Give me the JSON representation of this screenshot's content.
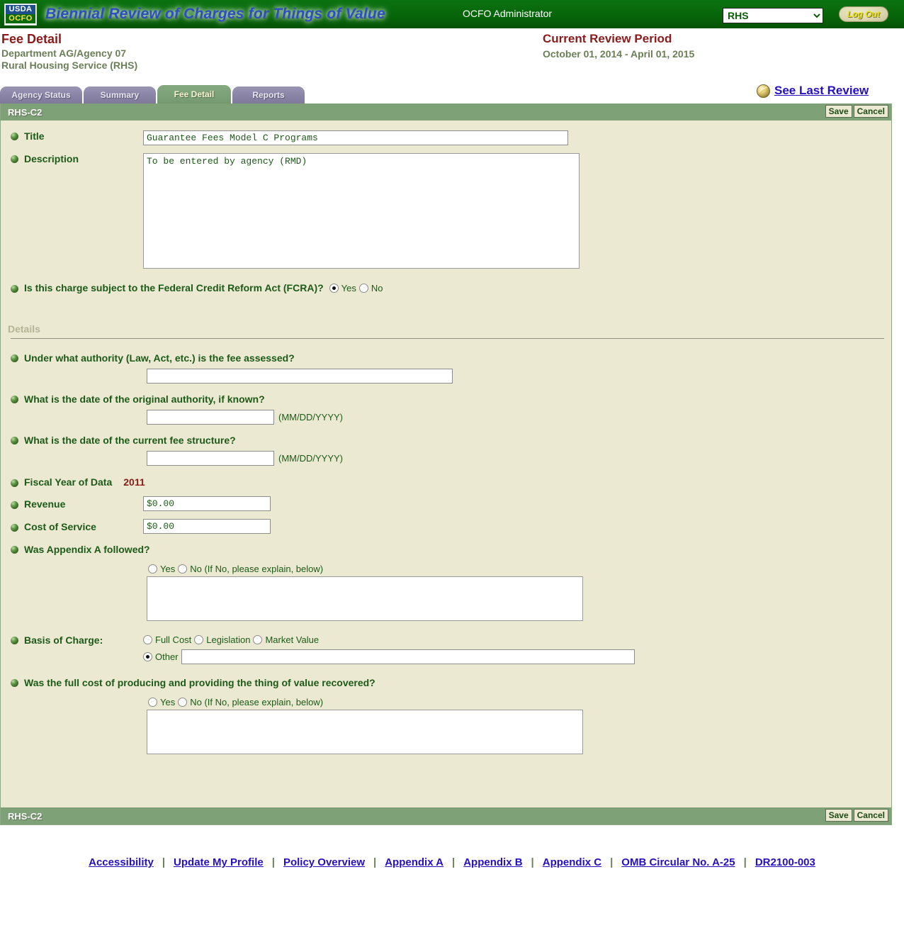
{
  "header": {
    "logo_top": "USDA",
    "logo_bottom": "OCFO",
    "banner_title": "Biennial Review of Charges for Things of Value",
    "user_role": "OCFO Administrator",
    "agency_selected": "RHS",
    "agency_options": [
      "RHS"
    ],
    "logout_label": "Log Out",
    "colors": {
      "bar_green": "#0a6b0a",
      "banner_blue": "#2a4fbe",
      "logout_bg": "#ddd8b0"
    }
  },
  "title_block": {
    "page_title": "Fee Detail",
    "department_line": "Department AG/Agency 07",
    "agency_line": "Rural Housing Service (RHS)",
    "review_period_title": "Current Review Period",
    "review_period_dates": "October 01, 2014 - April 01, 2015",
    "colors": {
      "maroon": "#8b1a1a",
      "sage": "#6b7f57"
    }
  },
  "see_last_review": {
    "icon": "globe-icon",
    "label": "See Last Review"
  },
  "tabs": [
    {
      "label": "Agency Status",
      "active": false
    },
    {
      "label": "Summary",
      "active": false
    },
    {
      "label": "Fee Detail",
      "active": true
    },
    {
      "label": "Reports",
      "active": false
    }
  ],
  "panel": {
    "header_title": "RHS-C2",
    "footer_title": "RHS-C2",
    "save_label": "Save",
    "cancel_label": "Cancel"
  },
  "form": {
    "title": {
      "label": "Title",
      "value": "Guarantee Fees Model C Programs",
      "placeholder": ""
    },
    "description": {
      "label": "Description",
      "value": "To be entered by agency (RMD)",
      "placeholder": ""
    },
    "fcra": {
      "label": "Is this charge subject to the Federal Credit Reform Act (FCRA)?",
      "options": [
        {
          "label": "Yes",
          "checked": true
        },
        {
          "label": "No",
          "checked": false
        }
      ]
    },
    "details_section_label": "Details",
    "authority": {
      "label": "Under what authority (Law, Act, etc.) is the fee assessed?",
      "value": "",
      "placeholder": ""
    },
    "original_authority_date": {
      "label": "What is the date of the original authority, if known?",
      "value": "",
      "placeholder": "",
      "hint": "(MM/DD/YYYY)"
    },
    "current_fee_structure_date": {
      "label": "What is the date of the current fee structure?",
      "value": "",
      "placeholder": "",
      "hint": "(MM/DD/YYYY)"
    },
    "fiscal_year": {
      "label": "Fiscal Year of Data",
      "value": "2011"
    },
    "revenue": {
      "label": "Revenue",
      "value": "$0.00"
    },
    "cost_of_service": {
      "label": "Cost of Service",
      "value": "$0.00"
    },
    "appendix_a": {
      "label": "Was Appendix A followed?",
      "options": [
        {
          "label": "Yes",
          "checked": false
        },
        {
          "label": "No (If No, please explain, below)",
          "checked": false
        }
      ],
      "explain_value": "",
      "explain_placeholder": ""
    },
    "basis_of_charge": {
      "label": "Basis of Charge:",
      "options": [
        {
          "label": "Full Cost",
          "checked": false
        },
        {
          "label": "Legislation",
          "checked": false
        },
        {
          "label": "Market Value",
          "checked": false
        },
        {
          "label": "Other",
          "checked": true
        }
      ],
      "other_value": "",
      "other_placeholder": ""
    },
    "full_cost_recovered": {
      "label": "Was the full cost of producing and providing the thing of value recovered?",
      "options": [
        {
          "label": "Yes",
          "checked": false
        },
        {
          "label": "No (If No, please explain, below)",
          "checked": false
        }
      ],
      "explain_value": "",
      "explain_placeholder": ""
    }
  },
  "footer": {
    "links": [
      "Accessibility",
      "Update My Profile",
      "Policy Overview",
      "Appendix A",
      "Appendix B",
      "Appendix C",
      "OMB Circular No. A-25",
      "DR2100-003"
    ],
    "separator": "|"
  }
}
